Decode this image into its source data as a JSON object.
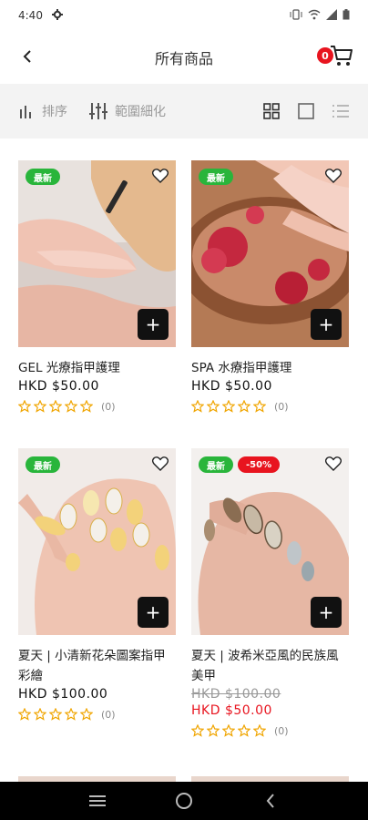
{
  "status_bar": {
    "time": "4:40",
    "icons": [
      "gear-icon",
      "vibrate-icon",
      "wifi-icon",
      "signal-icon",
      "battery-icon"
    ]
  },
  "header": {
    "title": "所有商品",
    "cart_count": "0"
  },
  "toolbar": {
    "sort_label": "排序",
    "filter_label": "範圍細化"
  },
  "products": [
    {
      "badge_new": "最新",
      "name": "GEL 光療指甲護理",
      "price": "HKD $50.00",
      "rating_count": "(0)"
    },
    {
      "badge_new": "最新",
      "name": "SPA 水療指甲護理",
      "price": "HKD $50.00",
      "rating_count": "(0)"
    },
    {
      "badge_new": "最新",
      "name": "夏天 | 小清新花朵圖案指甲彩繪",
      "price": "HKD $100.00",
      "rating_count": "(0)"
    },
    {
      "badge_new": "最新",
      "badge_sale": "-50%",
      "name": "夏天 | 波希米亞風的民族風美甲",
      "old_price": "HKD $100.00",
      "sale_price": "HKD $50.00",
      "rating_count": "(0)"
    }
  ],
  "colors": {
    "accent_red": "#e8141f",
    "badge_green": "#29b53b",
    "star_gold": "#f0a500"
  }
}
